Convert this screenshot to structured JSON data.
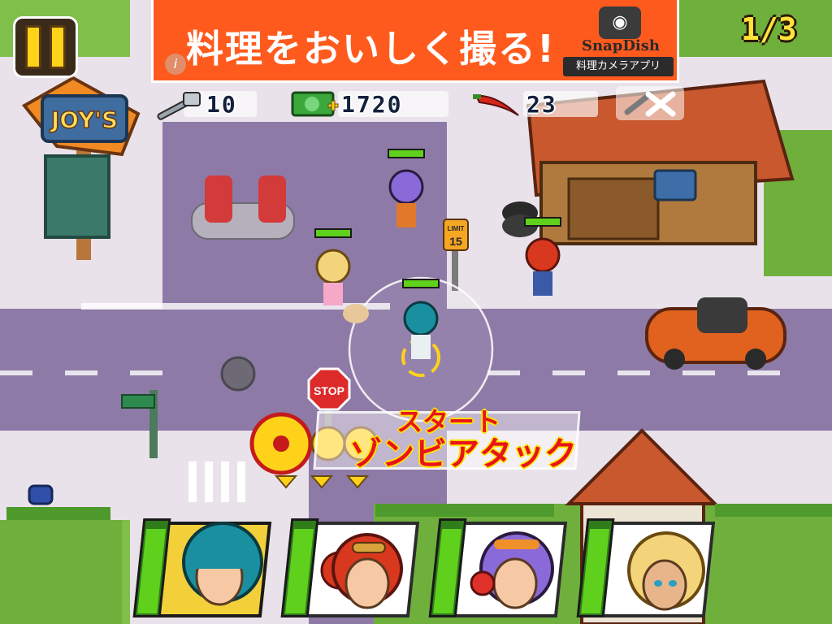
{
  "ad": {
    "title": "料理をおいしく撮る!",
    "brand": "SnapDish",
    "subtitle": "料理カメラアプリ",
    "info_icon": "i"
  },
  "hud": {
    "wave": "1/3",
    "tools_count": "10",
    "money_count": "1720",
    "chili_count": "23",
    "pause_icon": "pause-icon",
    "settings_icon": "hammer-wrench-icon"
  },
  "scene_signs": {
    "store_sign": "JOY'S",
    "stop_sign": "STOP",
    "speed_limit_top": "LIMIT",
    "speed_limit_value": "15"
  },
  "attack_banner": {
    "top": "スタート",
    "label": "ゾンビアタック"
  },
  "characters": [
    {
      "name": "teal-hair",
      "hair": "#1a8fa0",
      "energy": 0.9,
      "selected": true
    },
    {
      "name": "red-pigtails",
      "hair": "#d8381e",
      "energy": 0.9,
      "selected": false
    },
    {
      "name": "purple-headphones",
      "hair": "#8a6ad8",
      "energy": 0.9,
      "selected": false
    },
    {
      "name": "blonde",
      "hair": "#f4d47a",
      "energy": 0.9,
      "selected": false
    }
  ],
  "colors": {
    "road": "#8e7aa6",
    "sidewalk": "#e9e2ea",
    "grass": "#7fbf4a",
    "accent_red": "#e8141b",
    "energy_green": "#5fd11c"
  }
}
